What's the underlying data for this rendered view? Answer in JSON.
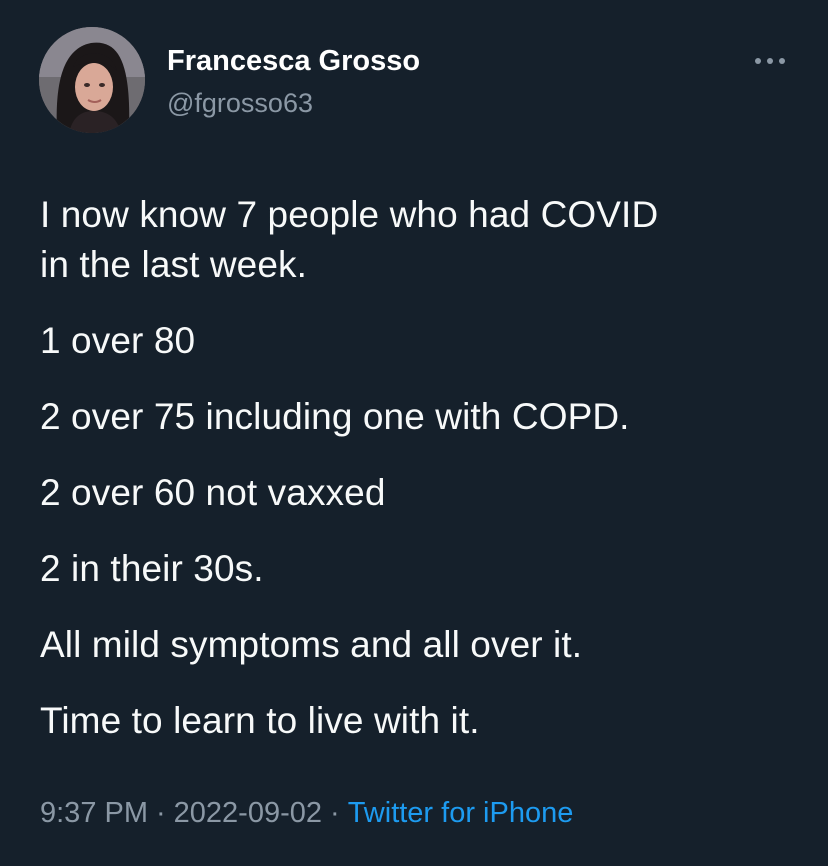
{
  "author": {
    "display_name": "Francesca Grosso",
    "handle": "@fgrosso63",
    "avatar_icon": "profile-photo"
  },
  "more_icon": "more-horizontal-icon",
  "tweet": {
    "lines": [
      "I now know 7 people who had COVID",
      "in the last week.",
      "1 over 80",
      "2 over 75 including one with COPD.",
      "2 over 60 not vaxxed",
      "2 in their 30s.",
      "All mild symptoms and all over it.",
      "Time to learn to live with it."
    ]
  },
  "meta": {
    "time": "9:37 PM",
    "separator": "·",
    "date": "2022-09-02",
    "source": "Twitter for iPhone"
  },
  "colors": {
    "background": "#15202b",
    "text": "#f7f9f9",
    "secondary": "#8b98a5",
    "link": "#1d9bf0"
  }
}
